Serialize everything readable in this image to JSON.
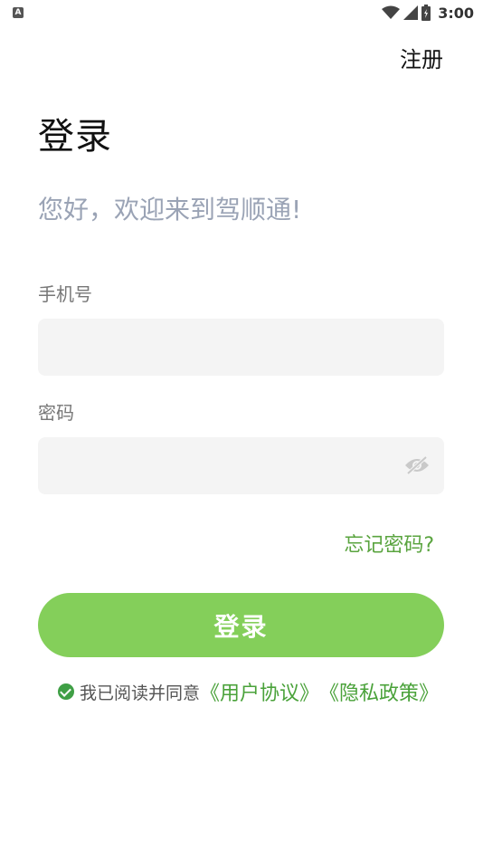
{
  "status_bar": {
    "notification_glyph": "A",
    "time": "3:00",
    "icons": [
      "wifi-icon",
      "signal-icon",
      "battery-icon"
    ]
  },
  "header": {
    "register_label": "注册"
  },
  "main": {
    "title": "登录",
    "welcome": "您好，欢迎来到驾顺通!",
    "phone_label": "手机号",
    "phone_value": "",
    "password_label": "密码",
    "password_value": "",
    "forgot_label": "忘记密码?",
    "login_button": "登录"
  },
  "agreement": {
    "text": "我已阅读并同意",
    "user_agreement": "《用户协议》",
    "privacy_policy": "《隐私政策》",
    "checked": true
  },
  "colors": {
    "accent": "#84cf5a",
    "link": "#4aa23a",
    "check": "#3f9f45",
    "welcome_text": "#9aa3b5"
  }
}
